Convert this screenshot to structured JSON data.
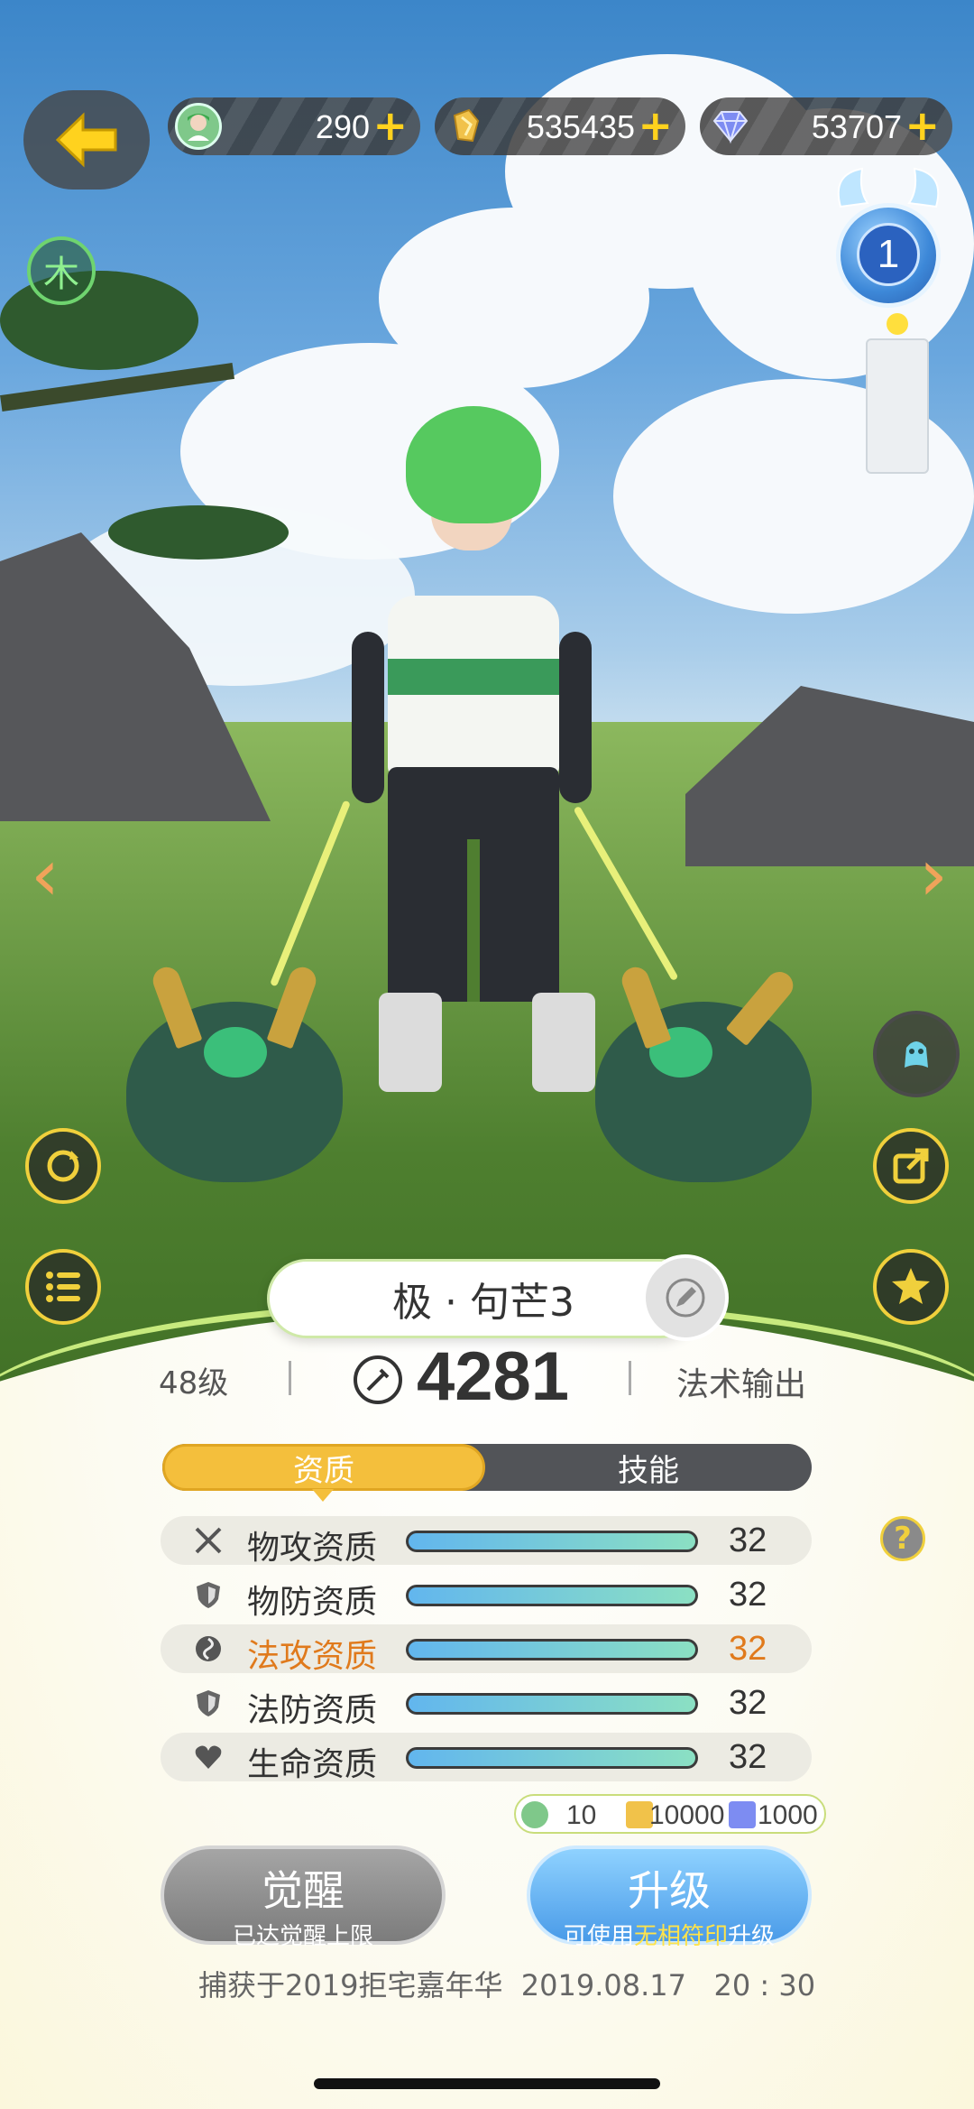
{
  "top_bar": {
    "back_icon": "arrow-left-icon",
    "resources": [
      {
        "icon": "avatar-token-icon",
        "value": "290",
        "plus": "+"
      },
      {
        "icon": "gold-crystal-icon",
        "value": "535435",
        "plus": "+"
      },
      {
        "icon": "diamond-icon",
        "value": "53707",
        "plus": "+"
      }
    ]
  },
  "element_badge": "木",
  "bell_badge": {
    "count": "1"
  },
  "character": {
    "name": "极 · 句芒3",
    "level": "48级",
    "power": "4281",
    "role": "法术输出"
  },
  "tabs": [
    {
      "label": "资质",
      "active": true
    },
    {
      "label": "技能",
      "active": false
    }
  ],
  "stats": [
    {
      "icon": "crossed-swords-icon",
      "label": "物攻资质",
      "value": "32",
      "fill": 1.0,
      "highlight": false
    },
    {
      "icon": "shield-icon",
      "label": "物防资质",
      "value": "32",
      "fill": 1.0,
      "highlight": false
    },
    {
      "icon": "magic-orb-icon",
      "label": "法攻资质",
      "value": "32",
      "fill": 1.0,
      "highlight": true
    },
    {
      "icon": "shield-icon",
      "label": "法防资质",
      "value": "32",
      "fill": 1.0,
      "highlight": false
    },
    {
      "icon": "heart-icon",
      "label": "生命资质",
      "value": "32",
      "fill": 1.0,
      "highlight": false
    }
  ],
  "cost": {
    "token": "10",
    "gold": "10000",
    "diamond": "1000"
  },
  "buttons": {
    "awaken": {
      "title": "觉醒",
      "subtitle": "已达觉醒上限"
    },
    "upgrade": {
      "title": "升级",
      "subtitle_pre": "可使用",
      "subtitle_highlight": "无相符印",
      "subtitle_post": "升级"
    }
  },
  "capture_info": "捕获于2019拒宅嘉年华  2019.08.17   20 : 30",
  "colors": {
    "accent_yellow": "#f4bf3c",
    "highlight_orange": "#e07a1c",
    "upgrade_blue": "#4a9be8"
  }
}
